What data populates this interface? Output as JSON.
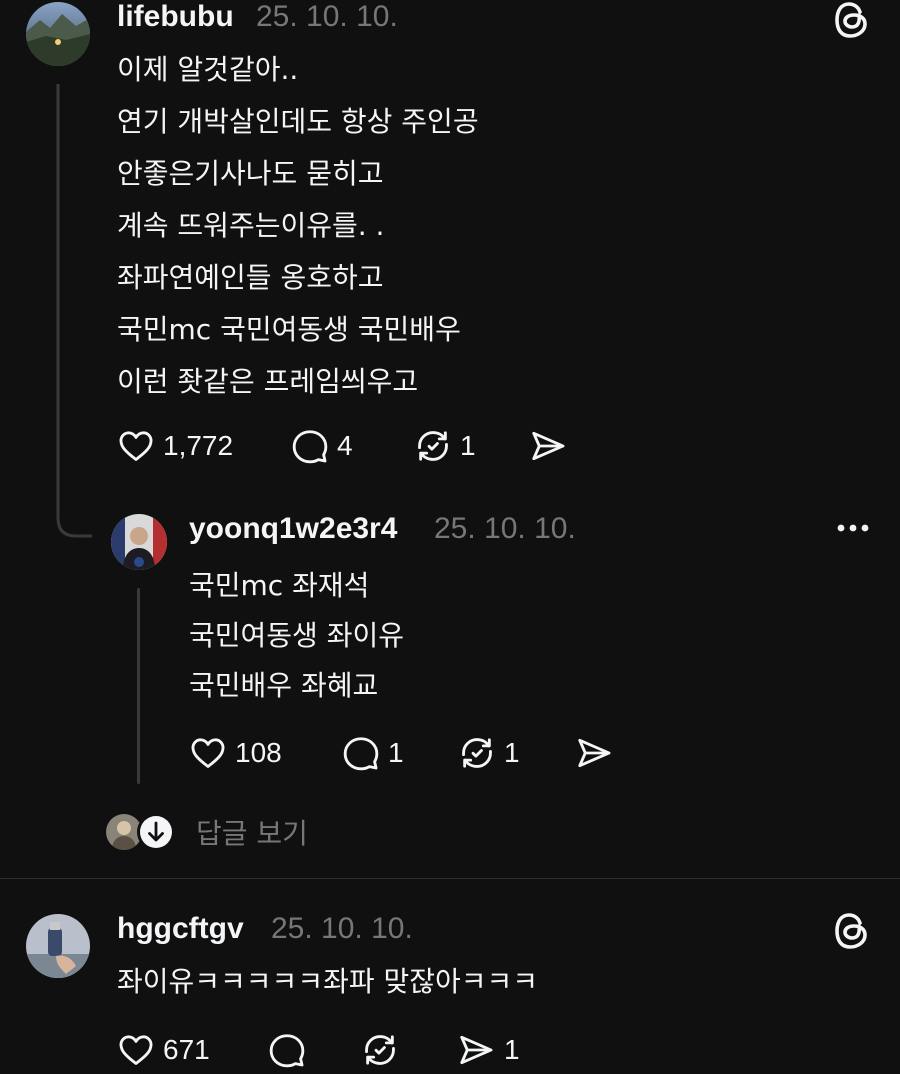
{
  "post1": {
    "username": "lifebubu",
    "timestamp": "25. 10. 10.",
    "lines": [
      "이제 알것같아..",
      "연기 개박살인데도 항상 주인공",
      "안좋은기사나도 묻히고",
      "계속 뜨워주는이유를. .",
      "좌파연예인들 옹호하고",
      "국민mc 국민여동생 국민배우",
      "이런 좟같은 프레임씌우고"
    ],
    "likes": "1,772",
    "replies": "4",
    "reposts": "1",
    "shares": ""
  },
  "reply1": {
    "username": "yoonq1w2e3r4",
    "timestamp": "25. 10. 10.",
    "lines": [
      "국민mc 좌재석",
      "국민여동생 좌이유",
      "국민배우 좌혜교"
    ],
    "likes": "108",
    "replies": "1",
    "reposts": "1",
    "shares": ""
  },
  "view_replies": {
    "label": "답글 보기"
  },
  "post2": {
    "username": "hggcftgv",
    "timestamp": "25. 10. 10.",
    "lines": [
      "좌이유ㅋㅋㅋㅋㅋ좌파 맞잖아ㅋㅋㅋ"
    ],
    "likes": "671",
    "replies": "",
    "reposts": "",
    "shares": "1"
  },
  "colors": {
    "background": "#101010",
    "text": "#f3f5f7",
    "muted": "#777777",
    "thread_line": "#3a3a3a"
  },
  "icons": [
    "threads-logo-icon",
    "heart-icon",
    "comment-icon",
    "repost-icon",
    "share-icon",
    "more-icon",
    "arrow-down-icon"
  ]
}
